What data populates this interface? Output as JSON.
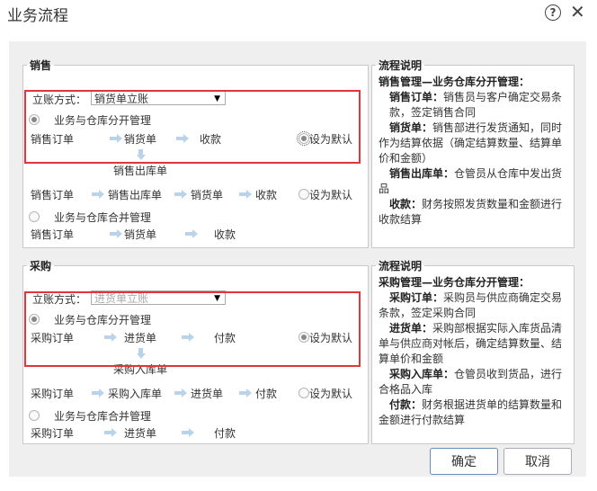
{
  "window": {
    "title": "业务流程"
  },
  "sales": {
    "legend": "销售",
    "account_method_label": "立账方式：",
    "account_method_value": "销货单立账",
    "separate": {
      "label": "业务与仓库分开管理",
      "step1": "销售订单",
      "step2": "销货单",
      "step3": "收款",
      "step_down": "销售出库单",
      "default_label": "设为默认"
    },
    "separate_alt": {
      "step1": "销售订单",
      "step2": "销售出库单",
      "step3": "销货单",
      "step4": "收款",
      "default_label": "设为默认"
    },
    "merged": {
      "label": "业务与仓库合并管理",
      "step1": "销售订单",
      "step2": "销货单",
      "step3": "收款"
    }
  },
  "sales_desc": {
    "legend": "流程说明",
    "head": "销售管理—业务仓库分开管理：",
    "items": [
      {
        "term": "销售订单：",
        "text": "销售员与客户确定交易条款，签定销售合同"
      },
      {
        "term": "销货单：",
        "text": "销售部进行发货通知，同时作为结算依据（确定结算数量、结算单价和金额）"
      },
      {
        "term": "销售出库单：",
        "text": "仓管员从仓库中发出货品"
      },
      {
        "term": "收款：",
        "text": "财务按照发货数量和金额进行收款结算"
      }
    ]
  },
  "purchase": {
    "legend": "采购",
    "account_method_label": "立账方式：",
    "account_method_value": "进货单立账",
    "separate": {
      "label": "业务与仓库分开管理",
      "step1": "采购订单",
      "step2": "进货单",
      "step3": "付款",
      "step_down": "采购入库单",
      "default_label": "设为默认"
    },
    "separate_alt": {
      "step1": "采购订单",
      "step2": "采购入库单",
      "step3": "进货单",
      "step4": "付款",
      "default_label": "设为默认"
    },
    "merged": {
      "label": "业务与仓库合并管理",
      "step1": "采购订单",
      "step2": "进货单",
      "step3": "付款"
    }
  },
  "purchase_desc": {
    "legend": "流程说明",
    "head": "采购管理—业务仓库分开管理：",
    "items": [
      {
        "term": "采购订单：",
        "text": "采购员与供应商确定交易条款，签定采购合同"
      },
      {
        "term": "进货单：",
        "text": "采购部根据实际入库货品清单与供应商对帐后，确定结算数量、结算单价和金额"
      },
      {
        "term": "采购入库单：",
        "text": "仓管员收到货品，进行合格品入库"
      },
      {
        "term": "付款：",
        "text": "财务根据进货单的结算数量和金额进行付款结算"
      }
    ]
  },
  "buttons": {
    "confirm": "确定",
    "cancel": "取消"
  },
  "colors": {
    "highlight": "#e0353b",
    "arrow": "#b9d4ea"
  }
}
